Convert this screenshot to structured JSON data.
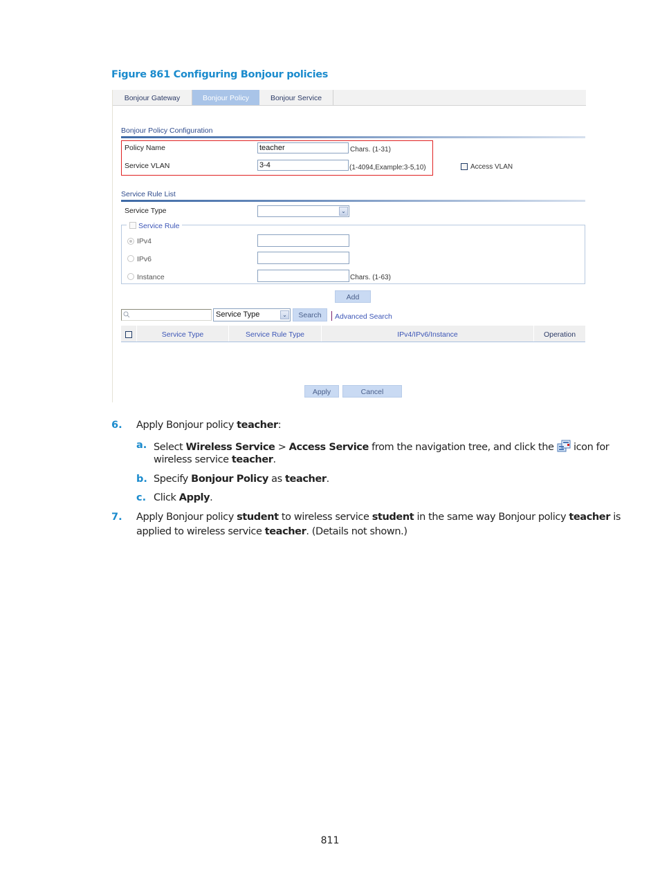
{
  "figure_title": "Figure 861 Configuring Bonjour policies",
  "tabs": [
    {
      "label": "Bonjour Gateway",
      "active": false
    },
    {
      "label": "Bonjour Policy",
      "active": true
    },
    {
      "label": "Bonjour Service",
      "active": false
    }
  ],
  "policy_config": {
    "section_title": "Bonjour Policy Configuration",
    "policy_name": {
      "label": "Policy Name",
      "value": "teacher",
      "hint": "Chars. (1-31)"
    },
    "service_vlan": {
      "label": "Service VLAN",
      "value": "3-4",
      "hint": "(1-4094,Example:3-5,10)"
    },
    "access_vlan": {
      "label": "Access VLAN",
      "checked": false
    }
  },
  "service_rule_list": {
    "section_title": "Service Rule List",
    "service_type": {
      "label": "Service Type",
      "value": ""
    },
    "service_rule": {
      "label": "Service Rule",
      "checked": false
    },
    "ipv4": {
      "label": "IPv4",
      "value": "",
      "selected": true
    },
    "ipv6": {
      "label": "IPv6",
      "value": "",
      "selected": false
    },
    "instance": {
      "label": "Instance",
      "value": "",
      "selected": false,
      "hint": "Chars. (1-63)"
    },
    "add_label": "Add"
  },
  "search": {
    "input_value": "",
    "field_select": "Service Type",
    "search_label": "Search",
    "advanced_label": "Advanced Search"
  },
  "table": {
    "columns": [
      "Service Type",
      "Service Rule Type",
      "IPv4/IPv6/Instance",
      "Operation"
    ],
    "rows": []
  },
  "buttons": {
    "apply": "Apply",
    "cancel": "Cancel"
  },
  "steps": {
    "s6": {
      "num": "6.",
      "t1": "Apply Bonjour policy ",
      "b1": "teacher",
      "t2": ":"
    },
    "s6a": {
      "num": "a.",
      "t1": "Select ",
      "b1": "Wireless Service",
      "t2": " > ",
      "b2": "Access Service",
      "t3": " from the navigation tree, and click the ",
      "t4": " icon for",
      "line2_t1": "wireless service ",
      "line2_b1": "teacher",
      "line2_t2": "."
    },
    "s6b": {
      "num": "b.",
      "t1": "Specify ",
      "b1": "Bonjour Policy",
      "t2": " as ",
      "b2": "teacher",
      "t3": "."
    },
    "s6c": {
      "num": "c.",
      "t1": "Click ",
      "b1": "Apply",
      "t2": "."
    },
    "s7": {
      "num": "7.",
      "t1": "Apply Bonjour policy ",
      "b1": "student",
      "t2": " to wireless service ",
      "b2": "student",
      "t3": " in the same way Bonjour policy ",
      "b3": "teacher",
      "t4": " is",
      "line2_t1": "applied to wireless service ",
      "line2_b1": "teacher",
      "line2_t2": ". (Details not shown.)"
    }
  },
  "page_number": "811",
  "colors": {
    "accent": "#1b8bcd",
    "active_tab": "#a9c4e8",
    "highlight_box": "#e02020",
    "button": "#c9daf3"
  }
}
